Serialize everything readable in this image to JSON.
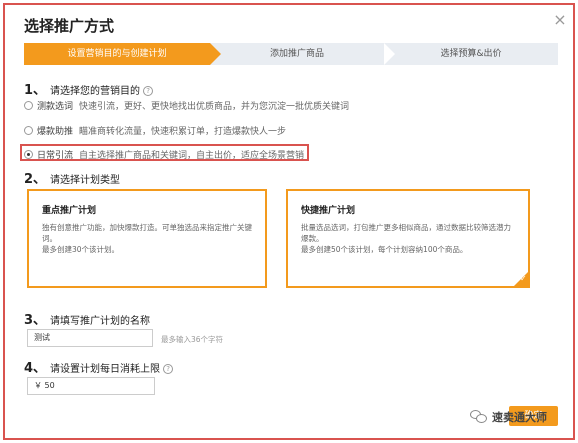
{
  "dialog": {
    "title": "选择推广方式",
    "close_symbol": "×"
  },
  "steps": [
    {
      "label": "设置营销目的与创建计划"
    },
    {
      "label": "添加推广商品"
    },
    {
      "label": "选择预算&出价"
    }
  ],
  "section1": {
    "num": "1、",
    "title": "请选择您的营销目的",
    "options": [
      {
        "label": "测款选词",
        "desc": "快速引流，更好、更快地找出优质商品，并为您沉淀一批优质关键词"
      },
      {
        "label": "爆款助推",
        "desc": "瞄准商转化流量，快速积累订单，打造爆款快人一步"
      },
      {
        "label": "日常引流",
        "desc": "自主选择推广商品和关键词，自主出价，适应全场景营销"
      }
    ]
  },
  "section2": {
    "num": "2、",
    "title": "请选择计划类型",
    "plans": [
      {
        "title": "重点推广计划",
        "desc": "独有创意推广功能，加快爆款打造。可单独选品来指定推广关键词。",
        "limit": "最多创建30个该计划。"
      },
      {
        "title": "快捷推广计划",
        "desc": "批量选品选词，打包推广更多相似商品，通过数据比较筛选潜力爆款。",
        "limit": "最多创建50个该计划，每个计划容纳100个商品。"
      }
    ],
    "check_symbol": "✓"
  },
  "section3": {
    "num": "3、",
    "title": "请填写推广计划的名称",
    "value": "测试",
    "hint": "最多输入36个字符"
  },
  "section4": {
    "num": "4、",
    "title": "请设置计划每日消耗上限",
    "value": "￥ 50"
  },
  "confirm_label": "确定",
  "watermark": {
    "text": "速卖通大师"
  },
  "help_symbol": "?"
}
